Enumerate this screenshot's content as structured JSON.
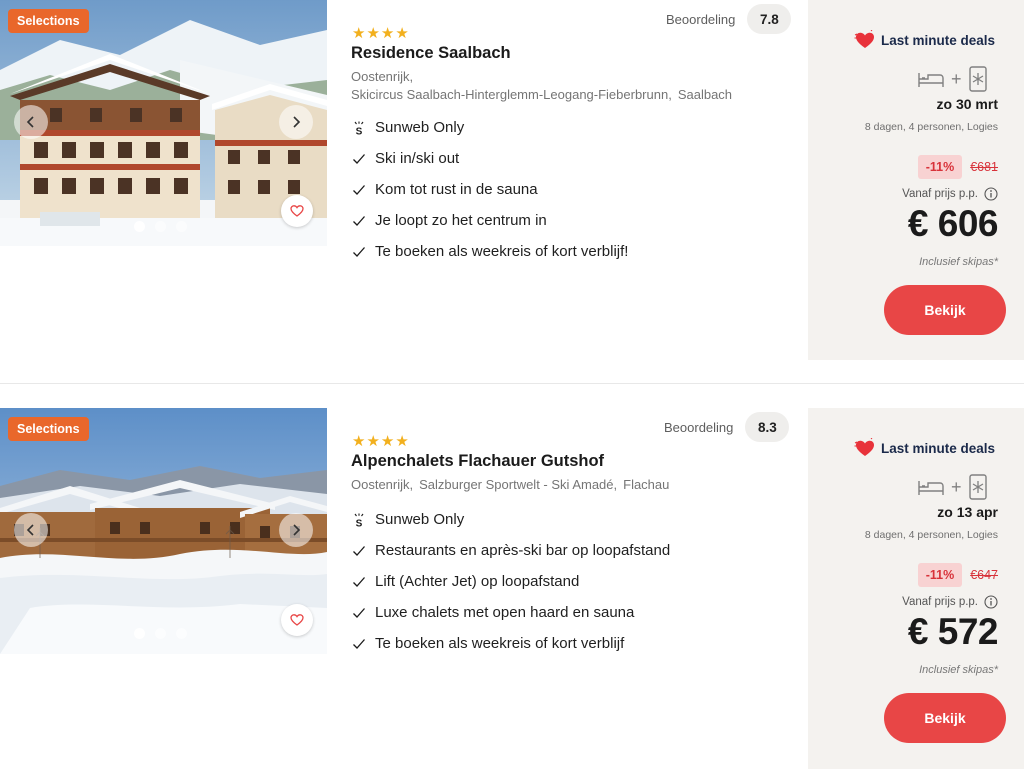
{
  "results": [
    {
      "badge": "Selections",
      "stars": "★★★★",
      "name": "Residence Saalbach",
      "location_line1": [
        "Oostenrijk,"
      ],
      "location_line2": [
        "Skicircus Saalbach-Hinterglemm-Leogang-Fieberbrunn,",
        "Saalbach"
      ],
      "rating_label": "Beoordeling",
      "rating_score": "7.8",
      "features": [
        {
          "icon": "sunweb-icon",
          "text": "Sunweb Only"
        },
        {
          "icon": "check-icon",
          "text": "Ski in/ski out"
        },
        {
          "icon": "check-icon",
          "text": "Kom tot rust in de sauna"
        },
        {
          "icon": "check-icon",
          "text": "Je loopt zo het centrum in"
        },
        {
          "icon": "check-icon",
          "text": "Te boeken als weekreis of kort verblijf!"
        }
      ],
      "deal_label": "Last minute deals",
      "date": "zo 30 mrt",
      "meta": "8 dagen, 4 personen, Logies",
      "discount": "-11%",
      "old_price": "€681",
      "from_label": "Vanaf prijs p.p.",
      "price": "€ 606",
      "price_note": "Inclusief skipas*",
      "cta": "Bekijk"
    },
    {
      "badge": "Selections",
      "stars": "★★★★",
      "name": "Alpenchalets Flachauer Gutshof",
      "location_line1": [
        "Oostenrijk,",
        "Salzburger Sportwelt - Ski Amadé,",
        "Flachau"
      ],
      "location_line2": [],
      "rating_label": "Beoordeling",
      "rating_score": "8.3",
      "features": [
        {
          "icon": "sunweb-icon",
          "text": "Sunweb Only"
        },
        {
          "icon": "check-icon",
          "text": "Restaurants en après-ski bar op loopafstand"
        },
        {
          "icon": "check-icon",
          "text": "Lift (Achter Jet) op loopafstand"
        },
        {
          "icon": "check-icon",
          "text": "Luxe chalets met open haard en sauna"
        },
        {
          "icon": "check-icon",
          "text": "Te boeken als weekreis of kort verblijf"
        }
      ],
      "deal_label": "Last minute deals",
      "date": "zo 13 apr",
      "meta": "8 dagen, 4 personen, Logies",
      "discount": "-11%",
      "old_price": "€647",
      "from_label": "Vanaf prijs p.p.",
      "price": "€ 572",
      "price_note": "Inclusief skipas*",
      "cta": "Bekijk"
    }
  ],
  "colors": {
    "badge": "#e9672b",
    "cta": "#e84646",
    "discount_bg": "#f8d2d2",
    "discount_text": "#d8323a",
    "stars": "#f2b01e",
    "panel_bg": "#f4f2ef"
  }
}
